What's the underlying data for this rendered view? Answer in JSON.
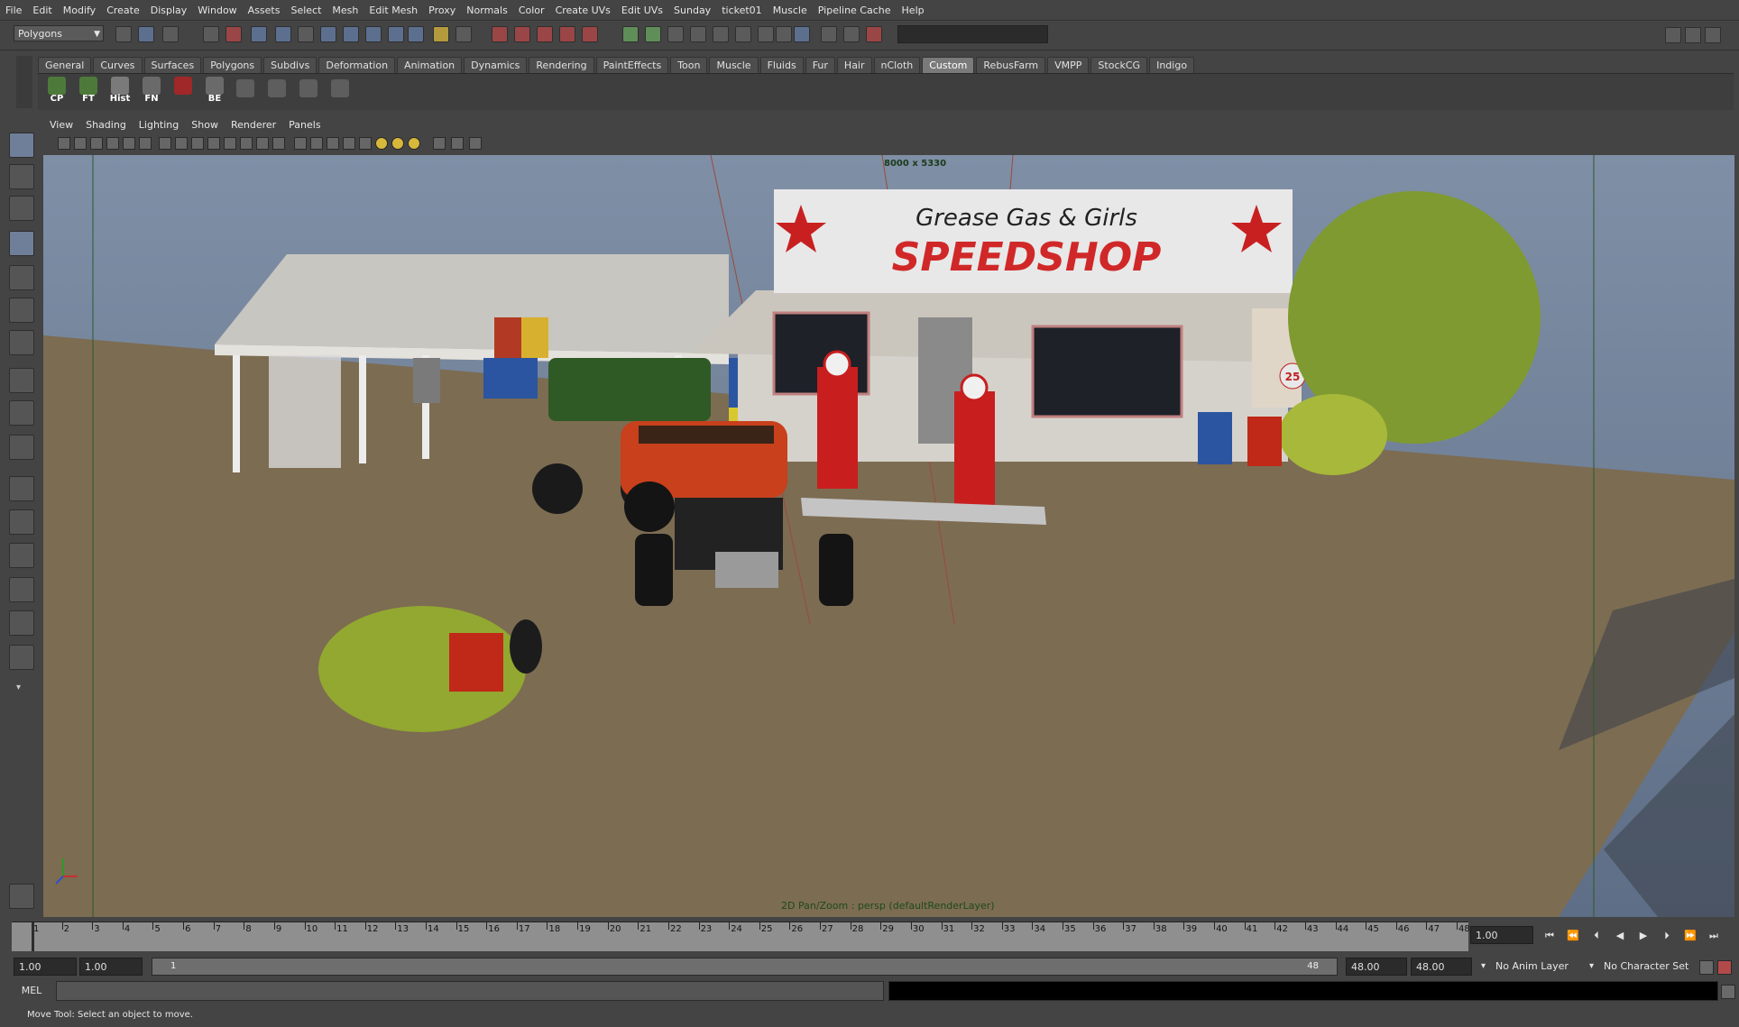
{
  "menus": [
    "File",
    "Edit",
    "Modify",
    "Create",
    "Display",
    "Window",
    "Assets",
    "Select",
    "Mesh",
    "Edit Mesh",
    "Proxy",
    "Normals",
    "Color",
    "Create UVs",
    "Edit UVs",
    "Sunday",
    "ticket01",
    "Muscle",
    "Pipeline Cache",
    "Help"
  ],
  "status_line": {
    "mode": "Polygons"
  },
  "shelf": {
    "tabs": [
      "General",
      "Curves",
      "Surfaces",
      "Polygons",
      "Subdivs",
      "Deformation",
      "Animation",
      "Dynamics",
      "Rendering",
      "PaintEffects",
      "Toon",
      "Muscle",
      "Fluids",
      "Fur",
      "Hair",
      "nCloth",
      "Custom",
      "RebusFarm",
      "VMPP",
      "StockCG",
      "Indigo"
    ],
    "active_tab": "Custom",
    "buttons": [
      "CP",
      "FT",
      "Hist",
      "FN",
      "",
      "BE"
    ]
  },
  "panel_menu": [
    "View",
    "Shading",
    "Lighting",
    "Show",
    "Renderer",
    "Panels"
  ],
  "viewport": {
    "resolution_gate": "8000 x 5330",
    "camera_label": "2D Pan/Zoom : persp (defaultRenderLayer)",
    "sign_line1": "Grease Gas & Girls",
    "sign_line2": "SPEEDSHOP",
    "small_sign": "25"
  },
  "timeline": {
    "ticks": [
      1,
      2,
      3,
      4,
      5,
      6,
      7,
      8,
      9,
      10,
      11,
      12,
      13,
      14,
      15,
      16,
      17,
      18,
      19,
      20,
      21,
      22,
      23,
      24,
      25,
      26,
      27,
      28,
      29,
      30,
      31,
      32,
      33,
      34,
      35,
      36,
      37,
      38,
      39,
      40,
      41,
      42,
      43,
      44,
      45,
      46,
      47,
      48
    ],
    "current_time": "1.00",
    "range_start": "1.00",
    "playback_start": "1.00",
    "range_slider_start": "1",
    "range_slider_end": "48",
    "playback_end": "48.00",
    "range_end": "48.00",
    "anim_layer": "No Anim Layer",
    "character_set": "No Character Set"
  },
  "command_line": {
    "label": "MEL"
  },
  "help_line": "Move Tool: Select an object to move."
}
